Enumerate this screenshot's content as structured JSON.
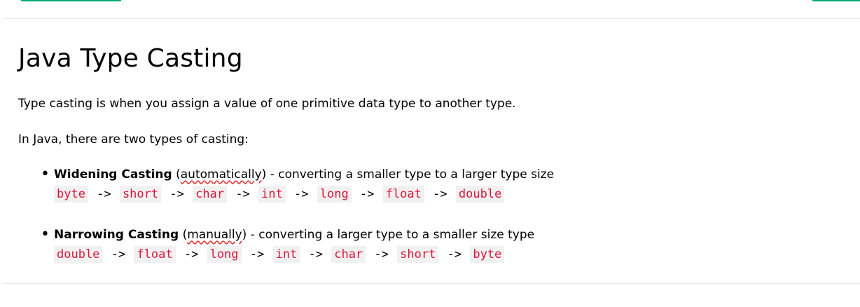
{
  "title": "Java Type Casting",
  "intro": "Type casting is when you assign a value of one primitive data type to another type.",
  "intro2": "In Java, there are two types of casting:",
  "arrow": "->",
  "widening": {
    "label": "Widening Casting",
    "paren_open": "(",
    "mode": "automatically",
    "paren_close": ")",
    "desc": " - converting a smaller type to a larger type size",
    "chain": [
      "byte",
      "short",
      "char",
      "int",
      "long",
      "float",
      "double"
    ]
  },
  "narrowing": {
    "label": "Narrowing Casting",
    "paren_open": "(",
    "mode": "manually",
    "paren_close": ")",
    "desc": " - converting a larger type to a smaller size type",
    "chain": [
      "double",
      "float",
      "long",
      "int",
      "char",
      "short",
      "byte"
    ]
  },
  "colors": {
    "accent": "#04AA6D",
    "code_text": "#dc143c",
    "code_bg": "#f1f1f1",
    "spellcheck": "#e03e3e"
  }
}
